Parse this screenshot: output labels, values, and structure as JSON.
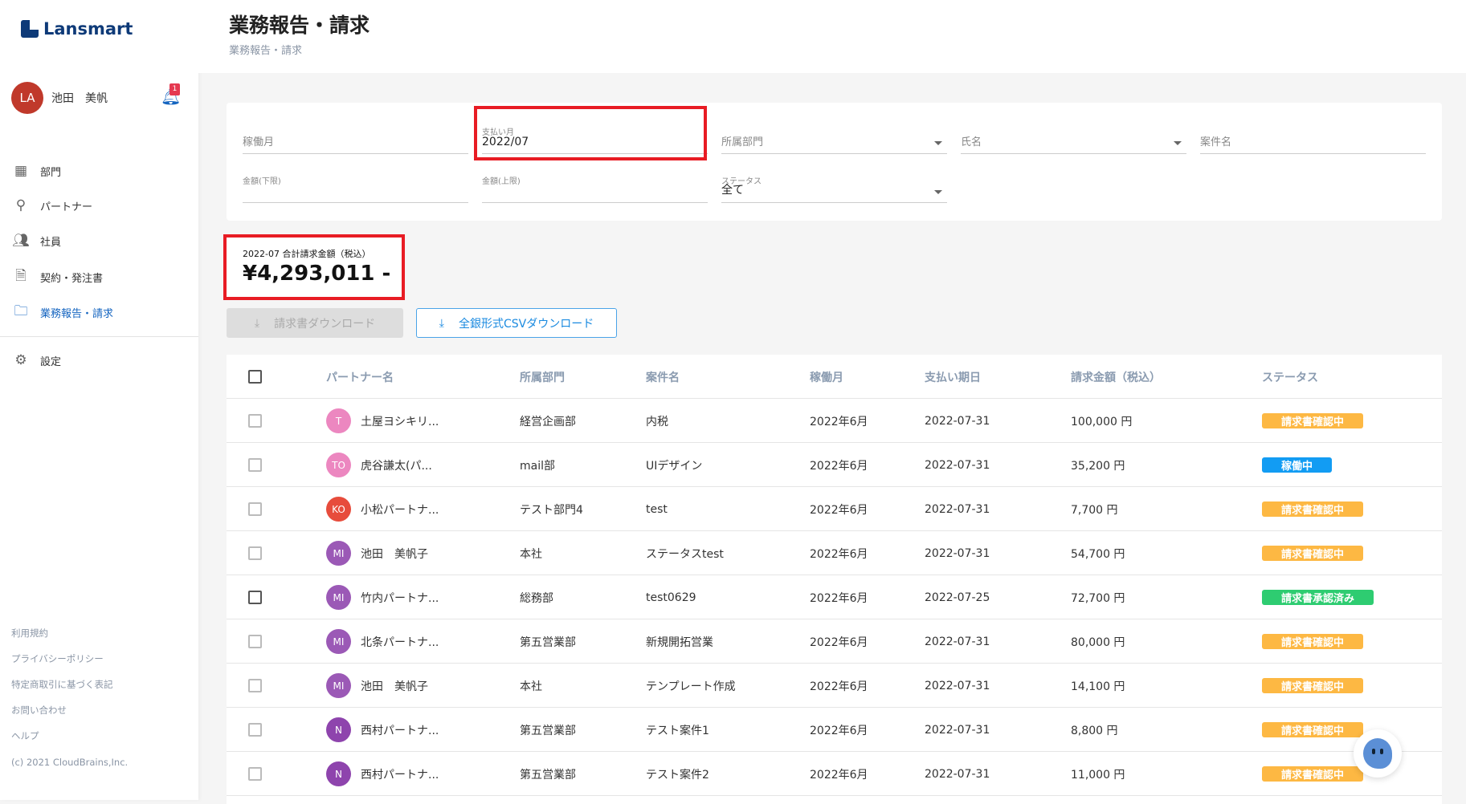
{
  "app": {
    "logo": "Lansmart"
  },
  "user": {
    "initials": "LA",
    "name": "池田　美帆",
    "notifications": "1"
  },
  "nav": [
    {
      "label": "部門",
      "icon": "building-icon"
    },
    {
      "label": "パートナー",
      "icon": "person-icon"
    },
    {
      "label": "社員",
      "icon": "people-icon"
    },
    {
      "label": "契約・発注書",
      "icon": "document-icon"
    },
    {
      "label": "業務報告・請求",
      "icon": "folder-icon",
      "active": true
    },
    {
      "label": "設定",
      "icon": "gear-icon"
    }
  ],
  "footer": [
    "利用規約",
    "プライバシーポリシー",
    "特定商取引に基づく表記",
    "お問い合わせ",
    "ヘルプ",
    "(c) 2021 CloudBrains,Inc."
  ],
  "header": {
    "title": "業務報告・請求",
    "breadcrumb": "業務報告・請求"
  },
  "filters": {
    "work_month": "稼働月",
    "pay_month_label": "支払い月",
    "pay_month_value": "2022/07",
    "department": "所属部門",
    "name": "氏名",
    "case_name": "案件名",
    "amount_min": "金額(下限)",
    "amount_max": "金額(上限)",
    "status_label": "ステータス",
    "status_value": "全て"
  },
  "summary": {
    "label": "2022-07 合計請求金額（税込）",
    "value": "¥4,293,011 -"
  },
  "buttons": {
    "invoice_download": "請求書ダウンロード",
    "csv_download": "全銀形式CSVダウンロード"
  },
  "table": {
    "headers": [
      "パートナー名",
      "所属部門",
      "案件名",
      "稼働月",
      "支払い期日",
      "請求金額（税込）",
      "ステータス"
    ],
    "rows": [
      {
        "initials": "T",
        "avatar_color": "#ec87c0",
        "partner": "土屋ヨシキリ...",
        "dept": "経営企画部",
        "case": "内税",
        "month": "2022年6月",
        "due": "2022-07-31",
        "amount": "100,000 円",
        "status": "請求書確認中",
        "status_color": "#fdb843"
      },
      {
        "initials": "TO",
        "avatar_color": "#ec87c0",
        "partner": "虎谷謙太(パ...",
        "dept": "mail部",
        "case": "UIデザイン",
        "month": "2022年6月",
        "due": "2022-07-31",
        "amount": "35,200 円",
        "status": "稼働中",
        "status_color": "#129cf3"
      },
      {
        "initials": "KO",
        "avatar_color": "#e74c3c",
        "partner": "小松パートナ...",
        "dept": "テスト部門4",
        "case": "test",
        "month": "2022年6月",
        "due": "2022-07-31",
        "amount": "7,700 円",
        "status": "請求書確認中",
        "status_color": "#fdb843"
      },
      {
        "initials": "MI",
        "avatar_color": "#9b59b6",
        "partner": "池田　美帆子",
        "dept": "本社",
        "case": "ステータスtest",
        "month": "2022年6月",
        "due": "2022-07-31",
        "amount": "54,700 円",
        "status": "請求書確認中",
        "status_color": "#fdb843"
      },
      {
        "initials": "MI",
        "avatar_color": "#9b59b6",
        "partner": "竹内パートナ...",
        "dept": "総務部",
        "case": "test0629",
        "month": "2022年6月",
        "due": "2022-07-25",
        "amount": "72,700 円",
        "status": "請求書承認済み",
        "status_color": "#2ecc71"
      },
      {
        "initials": "MI",
        "avatar_color": "#9b59b6",
        "partner": "北条パートナ...",
        "dept": "第五営業部",
        "case": "新規開拓営業",
        "month": "2022年6月",
        "due": "2022-07-31",
        "amount": "80,000 円",
        "status": "請求書確認中",
        "status_color": "#fdb843"
      },
      {
        "initials": "MI",
        "avatar_color": "#9b59b6",
        "partner": "池田　美帆子",
        "dept": "本社",
        "case": "テンプレート作成",
        "month": "2022年6月",
        "due": "2022-07-31",
        "amount": "14,100 円",
        "status": "請求書確認中",
        "status_color": "#fdb843"
      },
      {
        "initials": "N",
        "avatar_color": "#8e44ad",
        "partner": "西村パートナ...",
        "dept": "第五営業部",
        "case": "テスト案件1",
        "month": "2022年6月",
        "due": "2022-07-31",
        "amount": "8,800 円",
        "status": "請求書確認中",
        "status_color": "#fdb843"
      },
      {
        "initials": "N",
        "avatar_color": "#8e44ad",
        "partner": "西村パートナ...",
        "dept": "第五営業部",
        "case": "テスト案件2",
        "month": "2022年6月",
        "due": "2022-07-31",
        "amount": "11,000 円",
        "status": "請求書確認中",
        "status_color": "#fdb843"
      }
    ]
  }
}
